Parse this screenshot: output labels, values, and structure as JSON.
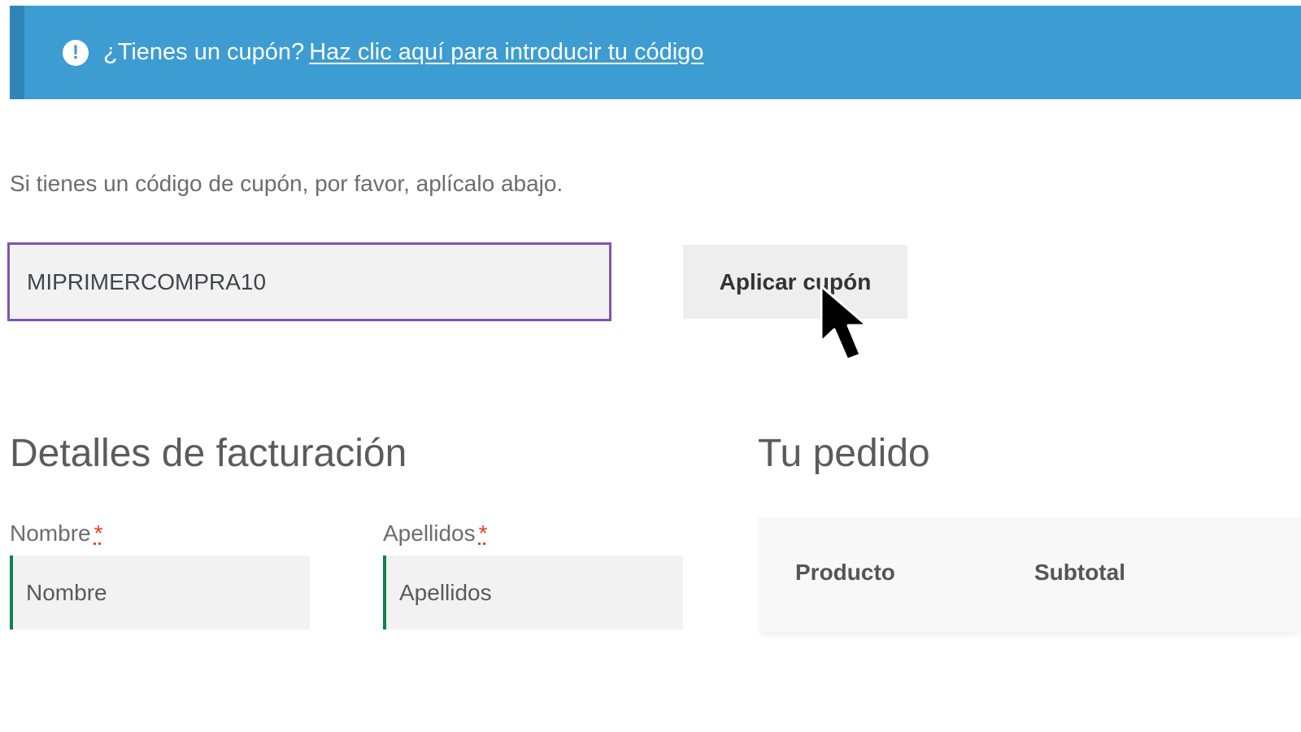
{
  "notice": {
    "icon": "exclamation-circle-icon",
    "text": "¿Tienes un cupón?",
    "link_text": "Haz clic aquí para introducir tu código",
    "colors": {
      "background": "#3d9cd2",
      "accent_border": "#2e86b8"
    }
  },
  "coupon": {
    "help_text": "Si tienes un código de cupón, por favor, aplícalo abajo.",
    "input_value": "MIPRIMERCOMPRA10",
    "apply_label": "Aplicar cupón",
    "focus_color": "#7f54b3"
  },
  "billing": {
    "title": "Detalles de facturación",
    "fields": [
      {
        "label": "Nombre",
        "required_mark": "*",
        "placeholder": "Nombre"
      },
      {
        "label": "Apellidos",
        "required_mark": "*",
        "placeholder": "Apellidos"
      }
    ],
    "valid_color": "#0f834d",
    "required_color": "#e2401c"
  },
  "order": {
    "title": "Tu pedido",
    "columns": [
      "Producto",
      "Subtotal"
    ]
  },
  "cursor": {
    "icon": "mouse-pointer-icon"
  }
}
